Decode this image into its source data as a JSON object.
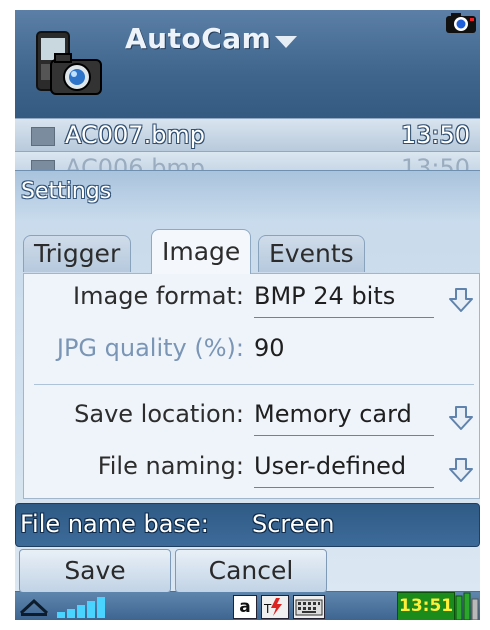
{
  "app": {
    "title": "AutoCam"
  },
  "files": [
    {
      "name": "AC007.bmp",
      "time": "13:50"
    },
    {
      "name": "AC006.bmp",
      "time": "13:50"
    }
  ],
  "dialog": {
    "title": "Settings",
    "tabs": [
      {
        "label": "Trigger",
        "active": false
      },
      {
        "label": "Image",
        "active": true
      },
      {
        "label": "Events",
        "active": false
      }
    ],
    "fields": {
      "image_format": {
        "label": "Image format:",
        "value": "BMP 24 bits"
      },
      "jpg_quality": {
        "label": "JPG quality (%):",
        "value": "90"
      },
      "save_location": {
        "label": "Save location:",
        "value": "Memory card"
      },
      "file_naming": {
        "label": "File naming:",
        "value": "User-defined"
      },
      "file_name_base": {
        "label": "File name base:",
        "value": "Screen"
      }
    },
    "buttons": {
      "save": "Save",
      "cancel": "Cancel"
    }
  },
  "statusbar": {
    "input_mode": "a",
    "time": "13:51"
  },
  "colors": {
    "accent": "#3d6b99",
    "dialog_bg": "#dbe7f2",
    "battery": "#1b8c1b",
    "clock": "#ffef3a"
  }
}
